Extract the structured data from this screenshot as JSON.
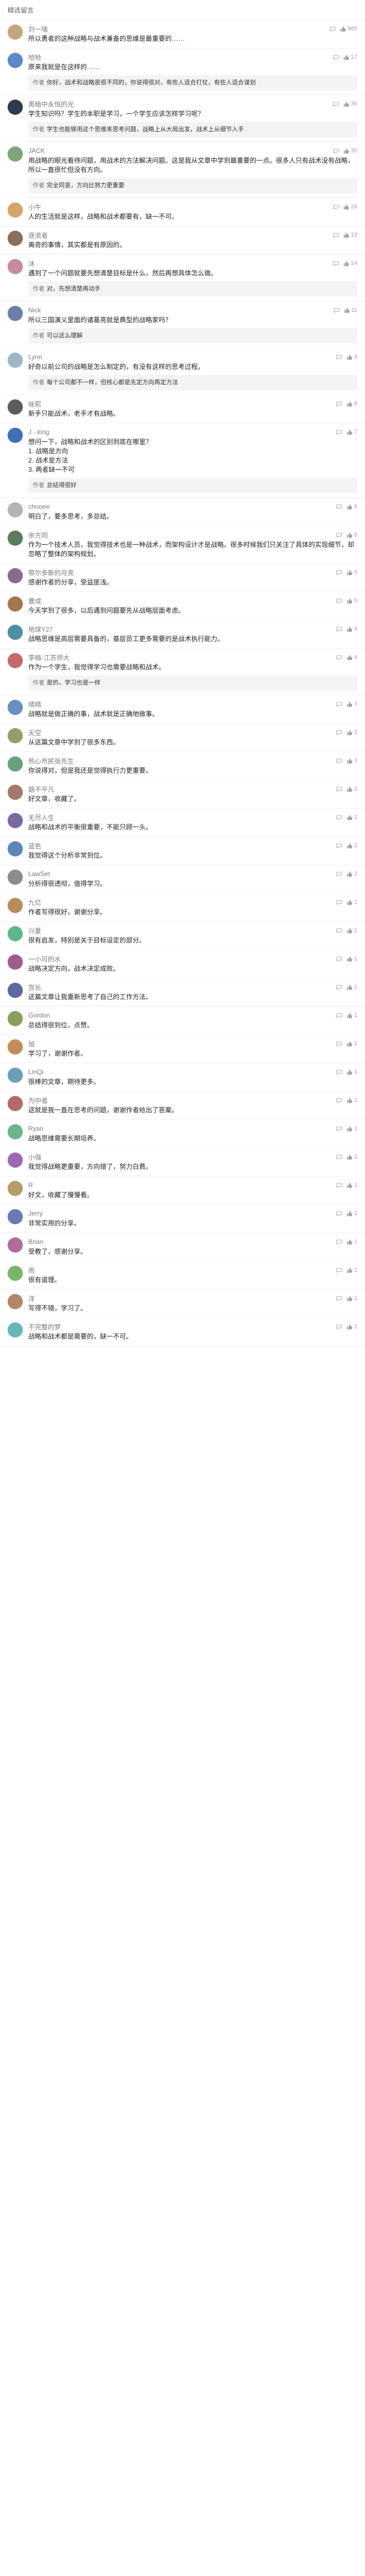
{
  "header": {
    "title": "精选留言"
  },
  "comments": [
    {
      "user": "刘一墙",
      "likes": "985",
      "text": "所以勇者的这种战略与战术兼备的思维是最重要的……",
      "color": "#c6a57d"
    },
    {
      "user": "哈哈",
      "likes": "17",
      "text": "原来我就是在这样的……",
      "reply_user": "作者",
      "reply": "你好，战术和战略是很不同的，你说得很对，有些人适合打仗，有些人适合谋划",
      "color": "#5b89c6"
    },
    {
      "user": "黑暗中永恒的光",
      "likes": "36",
      "text": "学生知识吗？学生的本职是学习，一个学生应该怎样学习呢？",
      "reply_user": "作者",
      "reply": "学生也能够用这个思维来思考问题，战略上从大局出发，战术上从细节入手",
      "color": "#2e3b4e"
    },
    {
      "user": "JACK",
      "likes": "30",
      "text": "用战略的眼光看待问题，用战术的方法解决问题。这是我从文章中学到最重要的一点。很多人只有战术没有战略，所以一直很忙但没有方向。",
      "reply_user": "作者",
      "reply": "完全同意，方向比努力更重要",
      "color": "#7fa37a"
    },
    {
      "user": "小牛",
      "likes": "26",
      "text": "人的生活就是这样，战略和战术都要有，缺一不可。",
      "color": "#d4a46a"
    },
    {
      "user": "逐浪者",
      "likes": "19",
      "text": "离奇的事情，其实都是有原因的。",
      "color": "#8b6f5b"
    },
    {
      "user": "沐",
      "likes": "14",
      "text": "遇到了一个问题就要先想清楚目标是什么，然后再想具体怎么做。",
      "reply_user": "作者",
      "reply": "对，先想清楚再动手",
      "color": "#c78b9c"
    },
    {
      "user": "Nick",
      "likes": "11",
      "text": "所以三国演义里面的诸葛亮就是典型的战略家吗？",
      "reply_user": "作者",
      "reply": "可以这么理解",
      "color": "#6a7ea8"
    },
    {
      "user": "Lynn",
      "likes": "9",
      "text": "好奇以前公司的战略是怎么制定的，有没有这样的思考过程。",
      "reply_user": "作者",
      "reply": "每个公司都不一样，但核心都是先定方向再定方法",
      "color": "#9fb6c9"
    },
    {
      "user": "咏熙",
      "likes": "8",
      "text": "新手只能战术，老手才有战略。",
      "color": "#5c5c5c"
    },
    {
      "user": "J · king",
      "likes": "7",
      "text": "想问一下，战略和战术的区别到底在哪里？\n1. 战略是方向\n2. 战术是方法\n3. 两者缺一不可",
      "reply_user": "作者",
      "reply": "总结得很好",
      "color": "#3f6fb5"
    },
    {
      "user": "chooee",
      "likes": "6",
      "text": "明白了，要多思考，多总结。",
      "color": "#b5b5b5"
    },
    {
      "user": "余方同",
      "likes": "6",
      "text": "作为一个技术人员，我觉得技术也是一种战术，而架构设计才是战略。很多时候我们只关注了具体的实现细节，却忽略了整体的架构规划。",
      "color": "#5a7d5a"
    },
    {
      "user": "鄂尔多斯的月亮",
      "likes": "5",
      "text": "感谢作者的分享，受益匪浅。",
      "color": "#8a6b95"
    },
    {
      "user": "曹成",
      "likes": "5",
      "text": "今天学到了很多，以后遇到问题要先从战略层面考虑。",
      "color": "#a0774e"
    },
    {
      "user": "地球Y27",
      "likes": "4",
      "text": "战略思维是高层需要具备的，基层员工更多需要的是战术执行能力。",
      "color": "#4e8fa0"
    },
    {
      "user": "李楠-江苏师大",
      "likes": "4",
      "text": "作为一个学生，我觉得学习也需要战略和战术。",
      "reply_user": "作者",
      "reply": "是的，学习也是一样",
      "color": "#c46a6a"
    },
    {
      "user": "晴晴",
      "likes": "3",
      "text": "战略就是做正确的事，战术就是正确地做事。",
      "color": "#6a8fc4"
    },
    {
      "user": "天空",
      "likes": "3",
      "text": "从这篇文章中学到了很多东西。",
      "color": "#9b9b6a"
    },
    {
      "user": "热心市民张先生",
      "likes": "3",
      "text": "你说得对，但是我还是觉得执行力更重要。",
      "color": "#6aa07a"
    },
    {
      "user": "路不平凡",
      "likes": "2",
      "text": "好文章，收藏了。",
      "color": "#a07a6a"
    },
    {
      "user": "无尽人生",
      "likes": "2",
      "text": "战略和战术的平衡很重要，不能只顾一头。",
      "color": "#7a6aa0"
    },
    {
      "user": "蓝色",
      "likes": "2",
      "text": "我觉得这个分析非常到位。",
      "color": "#5c88b8"
    },
    {
      "user": "LawSet",
      "likes": "2",
      "text": "分析得很透彻，值得学习。",
      "color": "#8c8c8c"
    },
    {
      "user": "九亿",
      "likes": "1",
      "text": "作者写得很好，谢谢分享。",
      "color": "#b88c5c"
    },
    {
      "user": "兴夏",
      "likes": "1",
      "text": "很有启发，特别是关于目标设定的部分。",
      "color": "#5cb88c"
    },
    {
      "user": "一小可的水",
      "likes": "1",
      "text": "战略决定方向，战术决定成败。",
      "color": "#a05c8c"
    },
    {
      "user": "宫长",
      "likes": "1",
      "text": "这篇文章让我重新思考了自己的工作方法。",
      "color": "#5c6aa0"
    },
    {
      "user": "Gordon",
      "likes": "1",
      "text": "总结得很到位，点赞。",
      "color": "#8ca05c"
    },
    {
      "user": "旭",
      "likes": "1",
      "text": "学习了，谢谢作者。",
      "color": "#c48c5c"
    },
    {
      "user": "LinQi",
      "likes": "1",
      "text": "很棒的文章，期待更多。",
      "color": "#6a9fb5"
    },
    {
      "user": "为中者",
      "likes": "1",
      "text": "这就是我一直在思考的问题，谢谢作者给出了答案。",
      "color": "#b56a6a"
    },
    {
      "user": "Ryan",
      "likes": "1",
      "text": "战略思维需要长期培养。",
      "color": "#6ab58c"
    },
    {
      "user": "小强",
      "likes": "1",
      "text": "我觉得战略更重要，方向错了，努力白费。",
      "color": "#9c6ab5"
    },
    {
      "user": "R",
      "likes": "1",
      "text": "好文，收藏了慢慢看。",
      "color": "#b59c6a"
    },
    {
      "user": "Jerry",
      "likes": "1",
      "text": "非常实用的分享。",
      "color": "#6a7ab5"
    },
    {
      "user": "Brian",
      "likes": "1",
      "text": "受教了，感谢分享。",
      "color": "#b56a9c"
    },
    {
      "user": "雨",
      "likes": "1",
      "text": "很有道理。",
      "color": "#7ab56a"
    },
    {
      "user": "洋",
      "likes": "1",
      "text": "写得不错，学习了。",
      "color": "#b5856a"
    },
    {
      "user": "不完整的梦",
      "likes": "1",
      "text": "战略和战术都是需要的，缺一不可。",
      "color": "#6ab5b5"
    }
  ]
}
